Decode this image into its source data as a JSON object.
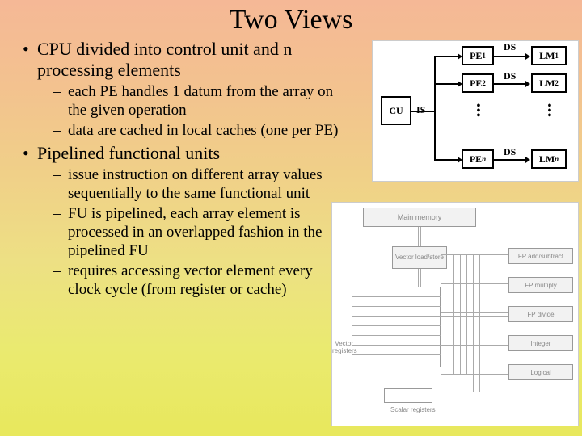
{
  "title": "Two Views",
  "bullets": [
    {
      "text": "CPU divided into control unit and n processing elements",
      "sub": [
        "each PE handles 1 datum from the array on the given operation",
        "data are cached in local caches (one per PE)"
      ]
    },
    {
      "text": "Pipelined functional units",
      "sub": [
        "issue instruction on different array values sequentially to the same functional unit",
        "FU is pipelined, each array element is processed in an overlapped fashion in the pipelined FU",
        "requires accessing vector element every clock cycle (from register or cache)"
      ]
    }
  ],
  "diagram1": {
    "cu": "CU",
    "is": "IS",
    "ds": "DS",
    "pe": [
      "PE",
      "PE",
      "PE"
    ],
    "pe_sub": [
      "1",
      "2",
      "n"
    ],
    "lm": [
      "LM",
      "LM",
      "LM"
    ],
    "lm_sub": [
      "1",
      "2",
      "n"
    ]
  },
  "diagram2": {
    "main_memory": "Main memory",
    "vector_ls": "Vector load/store",
    "vector_reg": "Vector registers",
    "scalar_reg": "Scalar registers",
    "fu": [
      "FP add/subtract",
      "FP multiply",
      "FP divide",
      "Integer",
      "Logical"
    ]
  }
}
